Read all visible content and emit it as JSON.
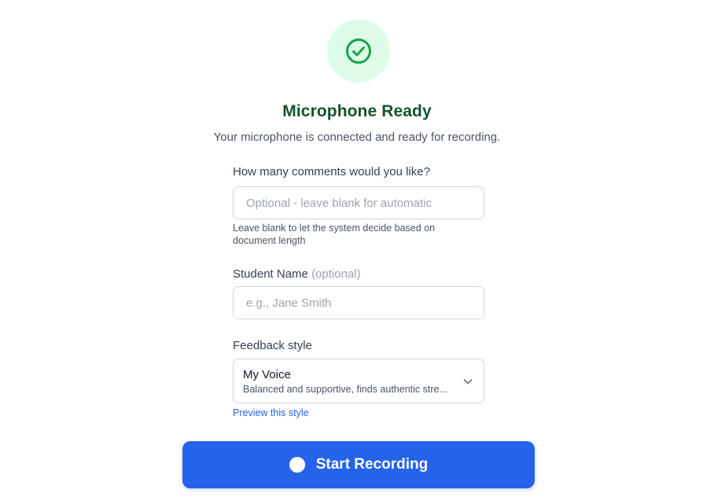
{
  "status": {
    "icon": "check-circle-icon",
    "title": "Microphone Ready",
    "message": "Your microphone is connected and ready for recording.",
    "colors": {
      "success_bg": "#dcfce7",
      "success_fg": "#16a34a",
      "title": "#14532d"
    }
  },
  "comments_field": {
    "label": "How many comments would you like?",
    "placeholder": "Optional - leave blank for automatic",
    "value": "",
    "hint": "Leave blank to let the system decide based on document length"
  },
  "student_field": {
    "label": "Student Name",
    "label_suffix": "(optional)",
    "placeholder": "e.g., Jane Smith",
    "value": ""
  },
  "feedback_style": {
    "label": "Feedback style",
    "selected": "My Voice",
    "description": "Balanced and supportive, finds authentic stre...",
    "dropdown_icon": "chevron-down-icon",
    "preview_link": "Preview this style"
  },
  "record_button": {
    "label": "Start Recording",
    "icon": "record-dot-icon",
    "color": "#2563eb"
  }
}
